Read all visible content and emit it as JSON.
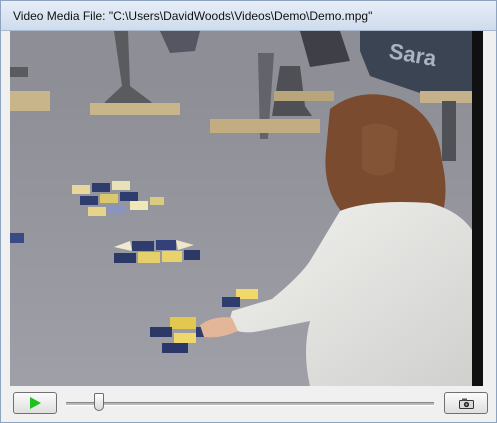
{
  "window": {
    "title": "Video Media File: \"C:\\Users\\DavidWoods\\Videos\\Demo\\Demo.mpg\""
  },
  "controls": {
    "position_fraction": 0.09,
    "buttons": [
      {
        "name": "play-button",
        "icon": "play-icon"
      },
      {
        "name": "snapshot-button",
        "icon": "camera-icon"
      }
    ]
  },
  "colors": {
    "play": "#20c020",
    "title_bar": "#d6e2f1",
    "background": "#f0f0f0"
  }
}
